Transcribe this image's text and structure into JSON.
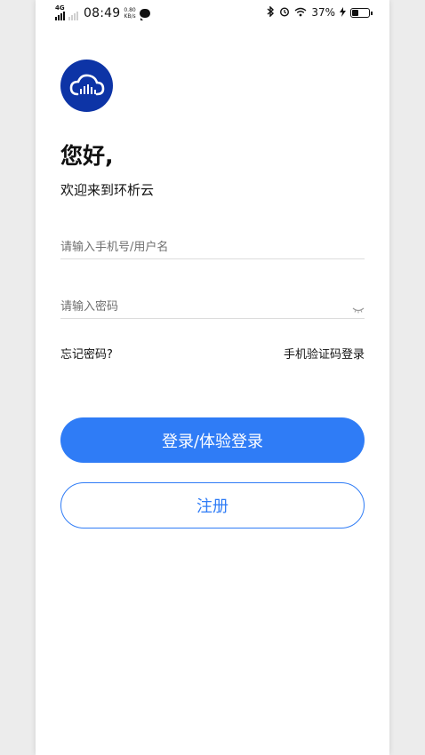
{
  "status_bar": {
    "network": "4G",
    "time": "08:49",
    "speed_value": "0.80",
    "speed_unit": "KB/s",
    "battery": "37%",
    "icons": [
      "signal-icon",
      "message-icon",
      "bluetooth-icon",
      "alarm-icon",
      "wifi-icon",
      "charging-icon",
      "battery-icon"
    ]
  },
  "app": {
    "logo_icon": "cloud-logo-icon",
    "brand_color": "#0d34a6",
    "accent_color": "#2f7cf6"
  },
  "header": {
    "greeting": "您好,",
    "welcome": "欢迎来到环析云"
  },
  "form": {
    "username_placeholder": "请输入手机号/用户名",
    "username_value": "",
    "password_placeholder": "请输入密码",
    "password_value": "",
    "password_toggle_icon": "eye-closed-icon"
  },
  "links": {
    "forgot_password": "忘记密码?",
    "sms_login": "手机验证码登录"
  },
  "buttons": {
    "login": "登录/体验登录",
    "register": "注册"
  }
}
